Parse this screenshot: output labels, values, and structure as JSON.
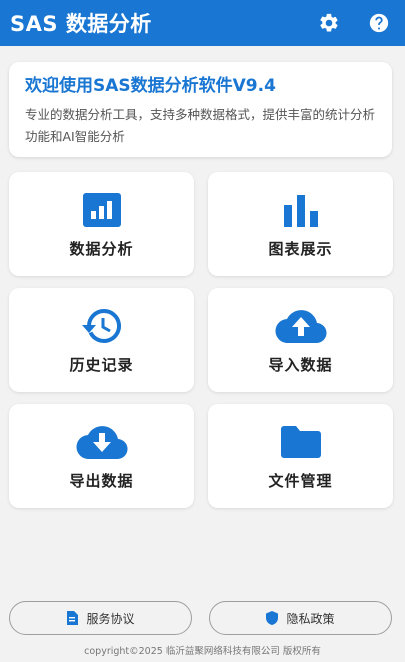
{
  "appbar": {
    "title": "SAS 数据分析",
    "settings_icon": "gear-icon",
    "help_icon": "help-icon"
  },
  "welcome": {
    "title": "欢迎使用SAS数据分析软件V9.4",
    "description": "专业的数据分析工具，支持多种数据格式，提供丰富的统计分析功能和AI智能分析"
  },
  "tiles": [
    {
      "label": "数据分析",
      "icon": "analytics-icon"
    },
    {
      "label": "图表展示",
      "icon": "bar-chart-icon"
    },
    {
      "label": "历史记录",
      "icon": "history-icon"
    },
    {
      "label": "导入数据",
      "icon": "cloud-upload-icon"
    },
    {
      "label": "导出数据",
      "icon": "cloud-download-icon"
    },
    {
      "label": "文件管理",
      "icon": "folder-icon"
    }
  ],
  "bottom_buttons": {
    "service_agreement": "服务协议",
    "privacy_policy": "隐私政策"
  },
  "footer": {
    "copyright": "copyright©2025 临沂益聚网络科技有限公司 版权所有"
  },
  "colors": {
    "primary": "#1976d2",
    "background": "#f2f2f2",
    "card": "#ffffff"
  }
}
